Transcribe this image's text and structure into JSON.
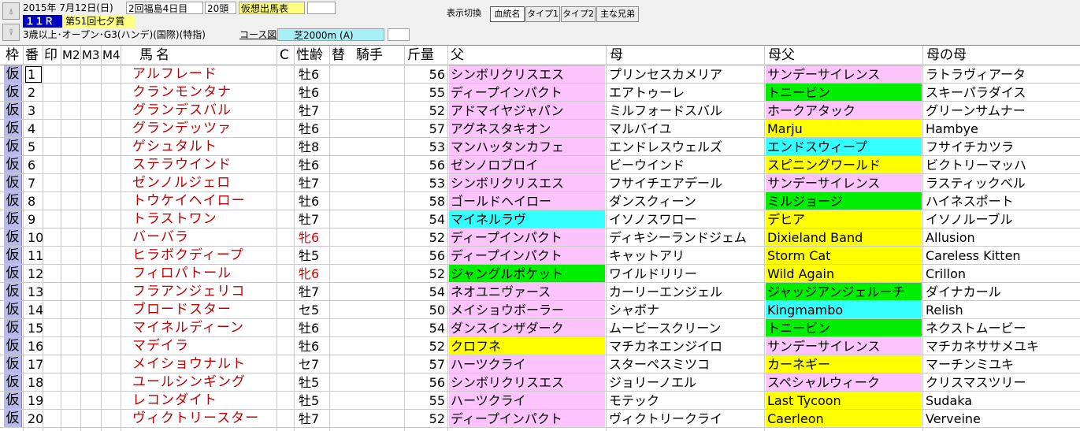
{
  "header": {
    "date": "2015年 7月12日(日)",
    "meeting": "2回福島4日目",
    "runners": "20頭",
    "mode_badge": "仮想出馬表",
    "race_no": "１１Ｒ",
    "race_name": "第51回七夕賞",
    "conditions": "3歳以上･オープン･G3(ハンデ)(国際)(特指)",
    "course_label": "コース図",
    "course": "芝2000m (A)",
    "icon_top": "⍋",
    "icon_bottom": "⍒"
  },
  "toolbar": {
    "display_switch": "表示切換",
    "tabs": [
      "血統名",
      "タイプ1",
      "タイプ2",
      "主な兄弟"
    ],
    "active_tab": "血統名"
  },
  "columns": {
    "waku": "枠",
    "ban": "番",
    "mark": "印",
    "m2": "M2",
    "m3": "M3",
    "m4": "M4",
    "name": "馬名",
    "c": "C",
    "sexage": "性齢",
    "change": "替",
    "jockey": "騎手",
    "weight": "斤量",
    "sire": "父",
    "dam": "母",
    "bms": "母父",
    "damdam": "母の母"
  },
  "colors": {
    "pink": "#fcc3fc",
    "yellow": "#ffff00",
    "cyan": "#33ffff",
    "green": "#00ee00",
    "waku": "#b9b9ec",
    "horse_name": "#c00000"
  },
  "rows": [
    {
      "waku": "仮",
      "num": "1",
      "name": "アルフレード",
      "sex": "牡6",
      "kin": "56",
      "sire": "シンボリクリスエス",
      "sire_c": "pink",
      "dam": "プリンセスカメリア",
      "bms": "サンデーサイレンス",
      "bms_c": "pink",
      "dd": "ラトラヴィアータ"
    },
    {
      "waku": "仮",
      "num": "2",
      "name": "クランモンタナ",
      "sex": "牡6",
      "kin": "55",
      "sire": "ディープインパクト",
      "sire_c": "pink",
      "dam": "エアトゥーレ",
      "bms": "トニービン",
      "bms_c": "green",
      "dd": "スキーパラダイス"
    },
    {
      "waku": "仮",
      "num": "3",
      "name": "グランデスバル",
      "sex": "牡7",
      "kin": "52",
      "sire": "アドマイヤジャパン",
      "sire_c": "pink",
      "dam": "ミルフォードスバル",
      "bms": "ホークアタック",
      "bms_c": "pink",
      "dd": "グリーンサムナー"
    },
    {
      "waku": "仮",
      "num": "4",
      "name": "グランデッツァ",
      "sex": "牡6",
      "kin": "57",
      "sire": "アグネスタキオン",
      "sire_c": "pink",
      "dam": "マルバイユ",
      "bms": "Marju",
      "bms_c": "yellow",
      "dd": "Hambye"
    },
    {
      "waku": "仮",
      "num": "5",
      "name": "ゲシュタルト",
      "sex": "牡8",
      "kin": "53",
      "sire": "マンハッタンカフェ",
      "sire_c": "pink",
      "dam": "エンドレスウェルズ",
      "bms": "エンドスウィープ",
      "bms_c": "cyan",
      "dd": "フサイチカツラ"
    },
    {
      "waku": "仮",
      "num": "6",
      "name": "ステラウインド",
      "sex": "牡6",
      "kin": "56",
      "sire": "ゼンノロブロイ",
      "sire_c": "pink",
      "dam": "ビーウインド",
      "bms": "スピニングワールド",
      "bms_c": "yellow",
      "dd": "ビクトリーマッハ"
    },
    {
      "waku": "仮",
      "num": "7",
      "name": "ゼンノルジェロ",
      "sex": "牡7",
      "kin": "53",
      "sire": "シンボリクリスエス",
      "sire_c": "pink",
      "dam": "フサイチエアデール",
      "bms": "サンデーサイレンス",
      "bms_c": "pink",
      "dd": "ラスティックベル"
    },
    {
      "waku": "仮",
      "num": "8",
      "name": "トウケイヘイロー",
      "sex": "牡6",
      "kin": "58",
      "sire": "ゴールドヘイロー",
      "sire_c": "pink",
      "dam": "ダンスクィーン",
      "bms": "ミルジョージ",
      "bms_c": "green",
      "dd": "ハイネスポート"
    },
    {
      "waku": "仮",
      "num": "9",
      "name": "トラストワン",
      "sex": "牡7",
      "kin": "54",
      "sire": "マイネルラヴ",
      "sire_c": "cyan",
      "dam": "イソノスワロー",
      "bms": "デヒア",
      "bms_c": "yellow",
      "dd": "イソノルーブル"
    },
    {
      "waku": "仮",
      "num": "10",
      "name": "バーバラ",
      "sex": "牝6",
      "kin": "52",
      "sire": "ディープインパクト",
      "sire_c": "pink",
      "dam": "ディキシーランドジェム",
      "bms": "Dixieland Band",
      "bms_c": "yellow",
      "dd": "Allusion"
    },
    {
      "waku": "仮",
      "num": "11",
      "name": "ヒラボクディープ",
      "sex": "牡5",
      "kin": "56",
      "sire": "ディープインパクト",
      "sire_c": "pink",
      "dam": "キャットアリ",
      "bms": "Storm Cat",
      "bms_c": "yellow",
      "dd": "Careless Kitten"
    },
    {
      "waku": "仮",
      "num": "12",
      "name": "フィロパトール",
      "sex": "牝6",
      "kin": "52",
      "sire": "ジャングルポケット",
      "sire_c": "green",
      "dam": "ワイルドリリー",
      "bms": "Wild Again",
      "bms_c": "yellow",
      "dd": "Crillon"
    },
    {
      "waku": "仮",
      "num": "13",
      "name": "フラアンジェリコ",
      "sex": "牡7",
      "kin": "54",
      "sire": "ネオユニヴァース",
      "sire_c": "pink",
      "dam": "カーリーエンジェル",
      "bms": "ジャッジアンジェルーチ",
      "bms_c": "green",
      "dd": "ダイナカール"
    },
    {
      "waku": "仮",
      "num": "14",
      "name": "ブロードスター",
      "sex": "セ5",
      "kin": "50",
      "sire": "メイショウボーラー",
      "sire_c": "pink",
      "dam": "シャボナ",
      "bms": "Kingmambo",
      "bms_c": "cyan",
      "dd": "Relish"
    },
    {
      "waku": "仮",
      "num": "15",
      "name": "マイネルディーン",
      "sex": "牡6",
      "kin": "54",
      "sire": "ダンスインザダーク",
      "sire_c": "pink",
      "dam": "ムービースクリーン",
      "bms": "トニービン",
      "bms_c": "green",
      "dd": "ネクストムービー"
    },
    {
      "waku": "仮",
      "num": "16",
      "name": "マデイラ",
      "sex": "牡6",
      "kin": "52",
      "sire": "クロフネ",
      "sire_c": "yellow",
      "dam": "マチカネエンジイロ",
      "bms": "サンデーサイレンス",
      "bms_c": "pink",
      "dd": "マチカネササメユキ"
    },
    {
      "waku": "仮",
      "num": "17",
      "name": "メイショウナルト",
      "sex": "セ7",
      "kin": "57",
      "sire": "ハーツクライ",
      "sire_c": "pink",
      "dam": "スターペスミツコ",
      "bms": "カーネギー",
      "bms_c": "yellow",
      "dd": "マーチンミユキ"
    },
    {
      "waku": "仮",
      "num": "18",
      "name": "ユールシンギング",
      "sex": "牡5",
      "kin": "56",
      "sire": "シンボリクリスエス",
      "sire_c": "pink",
      "dam": "ジョリーノエル",
      "bms": "スペシャルウィーク",
      "bms_c": "pink",
      "dd": "クリスマスツリー"
    },
    {
      "waku": "仮",
      "num": "19",
      "name": "レコンダイト",
      "sex": "牡5",
      "kin": "55",
      "sire": "ハーツクライ",
      "sire_c": "pink",
      "dam": "モテック",
      "bms": "Last Tycoon",
      "bms_c": "yellow",
      "dd": "Sudaka"
    },
    {
      "waku": "仮",
      "num": "20",
      "name": "ヴィクトリースター",
      "sex": "牡7",
      "kin": "52",
      "sire": "ディープインパクト",
      "sire_c": "pink",
      "dam": "ヴィクトリークライ",
      "bms": "Caerleon",
      "bms_c": "yellow",
      "dd": "Verveine"
    }
  ]
}
